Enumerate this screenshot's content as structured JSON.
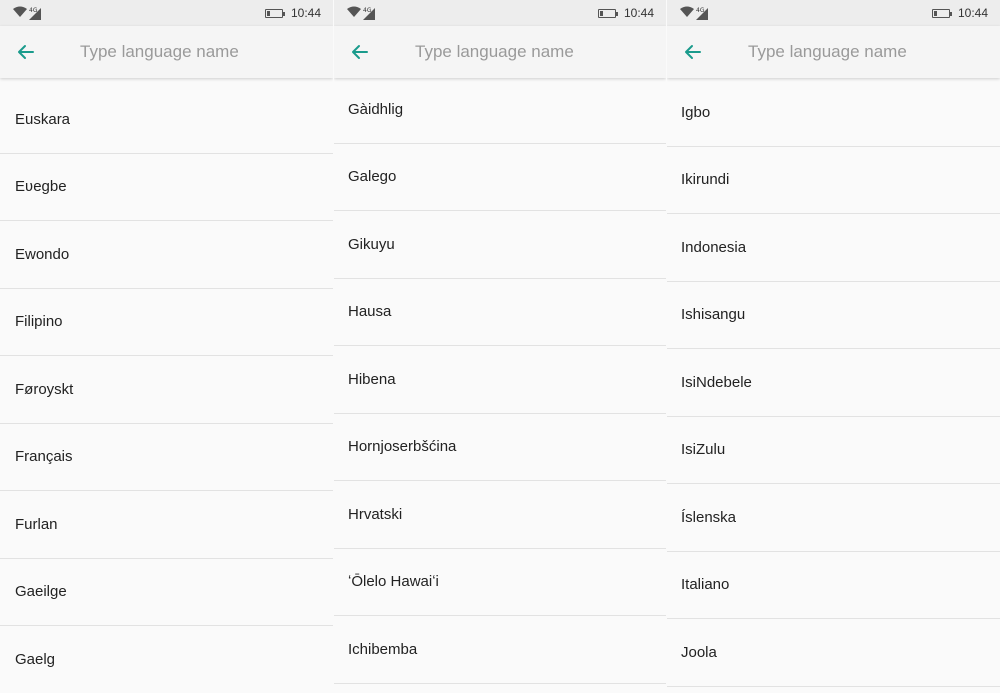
{
  "status_bar": {
    "network": "4G",
    "time": "10:44"
  },
  "colors": {
    "accent": "#1a9b8c",
    "background": "#fafafa",
    "appbar": "#f5f5f5",
    "divider": "#e2e2e2"
  },
  "screens": [
    {
      "search_placeholder": "Type language name",
      "items": [
        "Euskara",
        "Eʋegbe",
        "Ewondo",
        "Filipino",
        "Føroyskt",
        "Français",
        "Furlan",
        "Gaeilge",
        "Gaelg"
      ]
    },
    {
      "search_placeholder": "Type language name",
      "items": [
        "Gàidhlig",
        "Galego",
        "Gikuyu",
        "Hausa",
        "Hibena",
        "Hornjoserbšćina",
        "Hrvatski",
        "ʻŌlelo Hawaiʻi",
        "Ichibemba"
      ]
    },
    {
      "search_placeholder": "Type language name",
      "items": [
        "Igbo",
        "Ikirundi",
        "Indonesia",
        "Ishisangu",
        "IsiNdebele",
        "IsiZulu",
        "Íslenska",
        "Italiano",
        "Joola"
      ]
    }
  ]
}
